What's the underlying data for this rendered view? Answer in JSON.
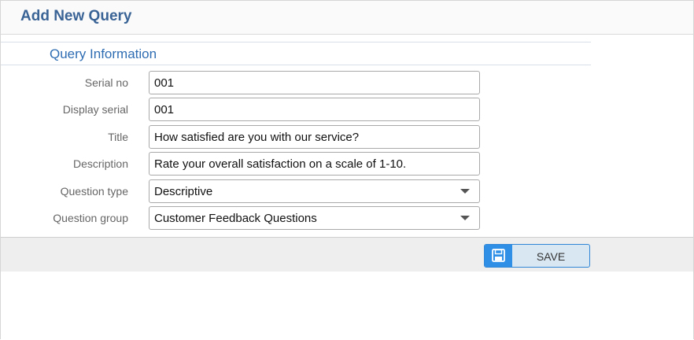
{
  "header": {
    "title": "Add New Query"
  },
  "section": {
    "title": "Query Information"
  },
  "form": {
    "serial_no": {
      "label": "Serial no",
      "value": "001"
    },
    "display_serial": {
      "label": "Display serial",
      "value": "001"
    },
    "title": {
      "label": "Title",
      "value": "How satisfied are you with our service?"
    },
    "description": {
      "label": "Description",
      "value": "Rate your overall satisfaction on a scale of 1-10."
    },
    "question_type": {
      "label": "Question type",
      "value": "Descriptive"
    },
    "question_group": {
      "label": "Question group",
      "value": "Customer Feedback Questions"
    }
  },
  "footer": {
    "save_label": "SAVE",
    "save_icon": "floppy-disk-icon"
  },
  "colors": {
    "header_title": "#3b6496",
    "section_title": "#2f6db3",
    "accent": "#2f8fe6",
    "save_button_bg": "#d9e7f3"
  }
}
